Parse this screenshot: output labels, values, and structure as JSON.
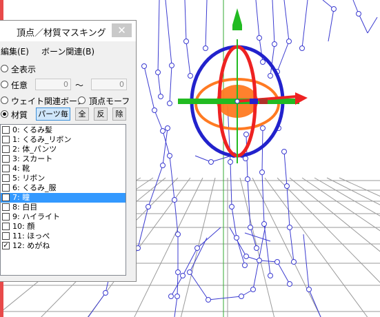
{
  "window": {
    "title": "頂点／材質マスキング",
    "close_glyph": "✕"
  },
  "menu": [
    {
      "label": "編集(E)"
    },
    {
      "label": "ボーン関連(B)"
    }
  ],
  "options": {
    "show_all": "全表示",
    "arbitrary": "任意",
    "range_from": "0",
    "range_sep": "〜",
    "range_to": "0",
    "weight_bone": "ウェイト関連ボーン",
    "vertex_morph": "頂点モーフ",
    "material": "材質",
    "per_part_button": "パーツ毎",
    "all_button": "全",
    "invert_button": "反",
    "remove_button": "除",
    "selected_mode": "材質"
  },
  "materials": [
    {
      "label": "0: くるみ髪",
      "checked": false,
      "selected": false
    },
    {
      "label": "1: くるみ_リボン",
      "checked": false,
      "selected": false
    },
    {
      "label": "2: 体_パンツ",
      "checked": false,
      "selected": false
    },
    {
      "label": "3: スカート",
      "checked": false,
      "selected": false
    },
    {
      "label": "4: 靴",
      "checked": false,
      "selected": false
    },
    {
      "label": "5: リボン",
      "checked": false,
      "selected": false
    },
    {
      "label": "6: くるみ_服",
      "checked": false,
      "selected": false
    },
    {
      "label": "7: 瞳",
      "checked": false,
      "selected": true
    },
    {
      "label": "8: 白目",
      "checked": false,
      "selected": false
    },
    {
      "label": "9: ハイライト",
      "checked": false,
      "selected": false
    },
    {
      "label": "10: 顔",
      "checked": false,
      "selected": false
    },
    {
      "label": "11: ほっぺ",
      "checked": false,
      "selected": false
    },
    {
      "label": "12: めがね",
      "checked": true,
      "selected": false
    }
  ],
  "colors": {
    "accent_bar": "#e84a4a",
    "bone": "#3a3ad0",
    "selection": "#3399ff",
    "gizmo_red": "#ee2222",
    "gizmo_green": "#22bb22",
    "gizmo_blue": "#2222cc",
    "gizmo_orange": "#ff7a22"
  }
}
